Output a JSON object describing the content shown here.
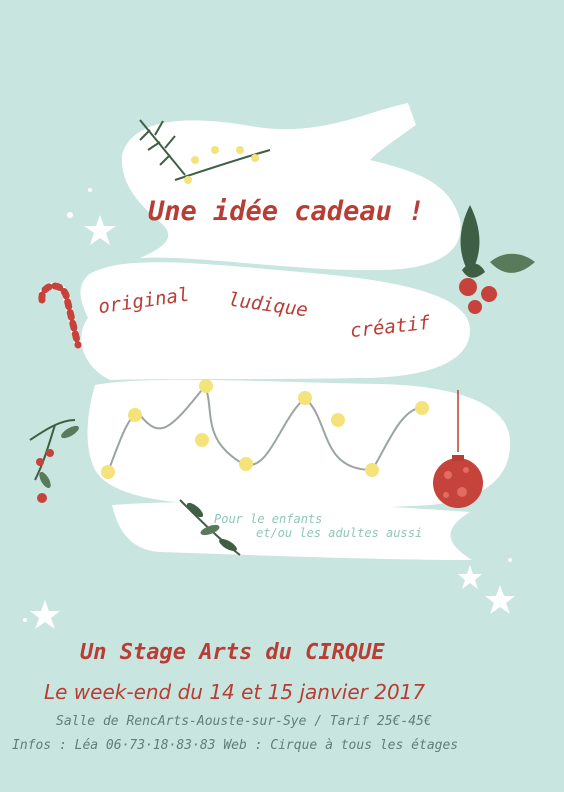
{
  "headline": "Une idée cadeau !",
  "qualities": [
    "original",
    "ludique",
    "créatif"
  ],
  "audience": {
    "line1": "Pour le enfants",
    "line2": "et/ou les adultes aussi"
  },
  "event": {
    "title": "Un Stage Arts du CIRQUE",
    "dates": "Le week-end du 14 et 15 janvier 2017",
    "location": "Salle de RencArts-Aouste-sur-Sye / Tarif 25€-45€",
    "contact": "Infos : Léa 06·73·18·83·83 Web : Cirque à tous les étages"
  },
  "colors": {
    "background": "#c9e5df",
    "ribbon": "#ffffff",
    "accent_red": "#b83d34",
    "leaf_green": "#3f5f45",
    "light_yellow": "#f4e37a"
  }
}
